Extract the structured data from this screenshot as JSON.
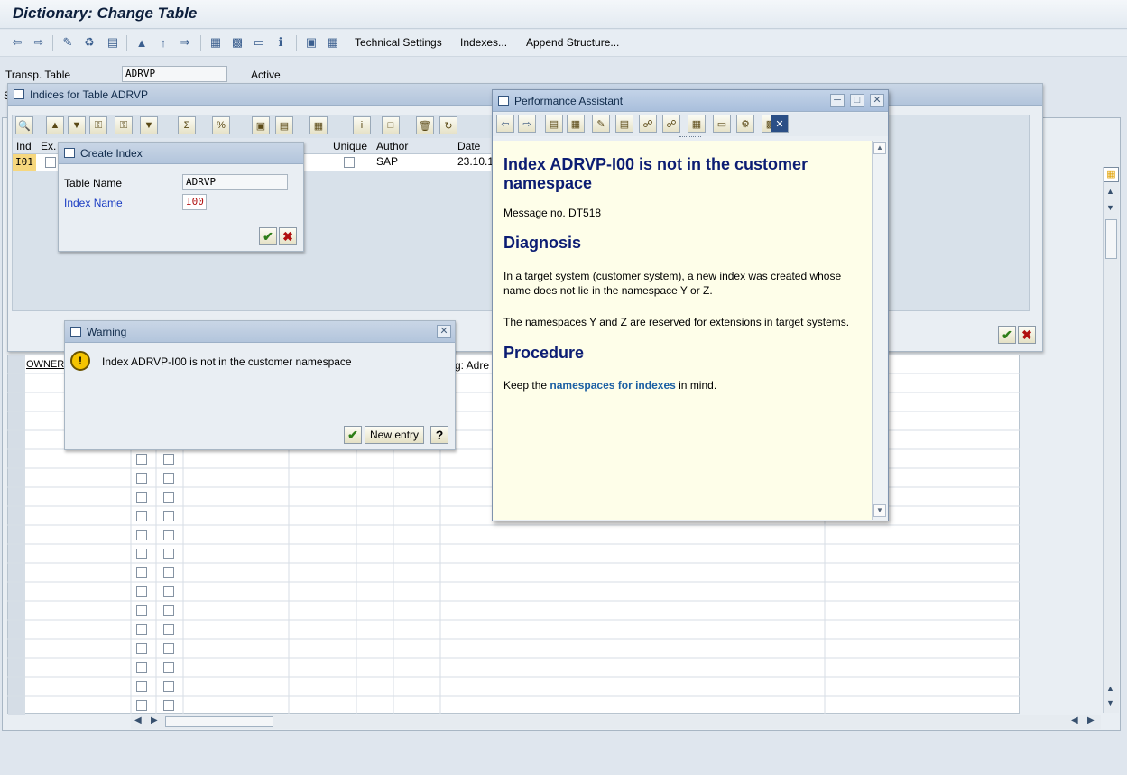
{
  "window": {
    "title": "Dictionary: Change Table"
  },
  "toolbar": {
    "technical_settings": "Technical Settings",
    "indexes": "Indexes...",
    "append_structure": "Append Structure..."
  },
  "header": {
    "transp_table_label": "Transp. Table",
    "transp_table_value": "ADRVP",
    "status": "Active"
  },
  "indices_dialog": {
    "title": "Indices for Table ADRVP",
    "columns": [
      "Ind",
      "Ex.",
      "Unique",
      "Author",
      "Date"
    ],
    "row": {
      "ind": "I01",
      "author": "SAP",
      "date": "23.10.1"
    }
  },
  "create_index_dialog": {
    "title": "Create Index",
    "table_name_label": "Table Name",
    "table_name_value": "ADRVP",
    "index_name_label": "Index Name",
    "index_name_value": "I00"
  },
  "warning_dialog": {
    "title": "Warning",
    "message": "Index ADRVP-I00 is not in the customer namespace",
    "new_entry_label": "New entry"
  },
  "fields_grid": {
    "owner_header": "OWNER",
    "partial_text": "g: Adre"
  },
  "performance_assistant": {
    "title": "Performance Assistant",
    "heading": "Index ADRVP-I00 is not in the customer namespace",
    "message_no": "Message no. DT518",
    "diagnosis_title": "Diagnosis",
    "diagnosis_text": "In a target system (customer system), a new index was created whose name does not lie in the namespace Y or Z.",
    "namespaces_text": "The namespaces Y and Z are reserved for extensions in target systems.",
    "procedure_title": "Procedure",
    "procedure_prefix": "Keep the",
    "procedure_link": "namespaces for indexes",
    "procedure_suffix": "in mind."
  },
  "colors": {
    "help_heading": "#0c1d73",
    "link": "#1b5fa3",
    "help_bg": "#fefee9"
  }
}
